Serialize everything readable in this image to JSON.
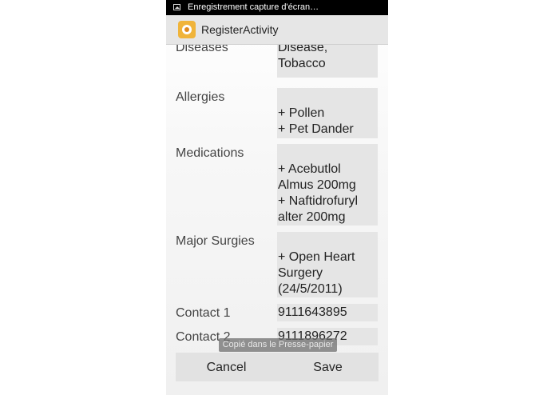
{
  "status_bar": {
    "notification": "Enregistrement capture d'écran…",
    "icon": "image-icon"
  },
  "action_bar": {
    "title": "RegisterActivity",
    "icon": "app-logo-icon"
  },
  "fields": [
    {
      "label": "Diseases",
      "lines": [
        "Disease,",
        "Tobacco"
      ]
    },
    {
      "label": "Allergies",
      "lines": [
        "",
        "+ Pollen",
        "+ Pet Dander"
      ]
    },
    {
      "label": "Medications",
      "lines": [
        "",
        "+ Acebutlol",
        "Almus 200mg",
        "+ Naftidrofuryl",
        "alter 200mg"
      ]
    },
    {
      "label": "Major Surgies",
      "lines": [
        "",
        "+ Open Heart",
        "Surgery",
        "(24/5/2011)"
      ]
    },
    {
      "label": "Contact 1",
      "lines": [
        "9111643895"
      ]
    },
    {
      "label": "Contact 2",
      "lines": [
        "9111896272"
      ]
    }
  ],
  "toast": "Copié dans le Presse-papier",
  "buttons": {
    "cancel": "Cancel",
    "save": "Save"
  },
  "colors": {
    "accent": "#f0b43a",
    "field_bg": "#e5e5e5",
    "button_bar": "#e2e2e2"
  }
}
